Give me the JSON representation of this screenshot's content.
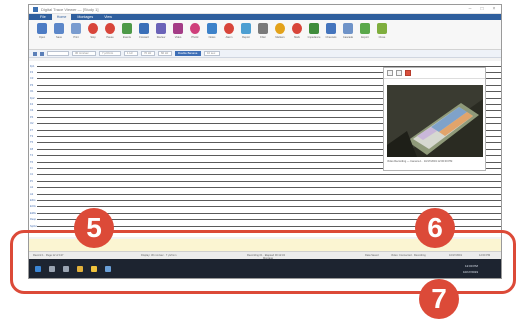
{
  "window": {
    "title": "Digital Trace Viewer — [Study 1]"
  },
  "menubar": {
    "items": [
      "File",
      "Home",
      "Montages",
      "View"
    ],
    "active_index": 1
  },
  "ribbon": {
    "buttons": [
      {
        "label": "Open",
        "color": "#4d7cc4",
        "shape": "square"
      },
      {
        "label": "Save",
        "color": "#5c87c9",
        "shape": "square"
      },
      {
        "label": "Print",
        "color": "#7a9ccf",
        "shape": "square"
      },
      {
        "label": "Stop",
        "color": "#d8453a",
        "shape": "round"
      },
      {
        "label": "Pause",
        "color": "#d8453a",
        "shape": "round"
      },
      {
        "label": "Events",
        "color": "#4e9a48",
        "shape": "square"
      },
      {
        "label": "Forward",
        "color": "#3a6fb8",
        "shape": "square"
      },
      {
        "label": "Review",
        "color": "#6b63b8",
        "shape": "square"
      },
      {
        "label": "Video",
        "color": "#a43c86",
        "shape": "square"
      },
      {
        "label": "Photic",
        "color": "#cf3f7b",
        "shape": "round"
      },
      {
        "label": "Notes",
        "color": "#3d82c9",
        "shape": "square"
      },
      {
        "label": "Alarm",
        "color": "#d8453a",
        "shape": "round"
      },
      {
        "label": "Report",
        "color": "#4d9fd2",
        "shape": "square"
      },
      {
        "label": "Filter",
        "color": "#7a7a7a",
        "shape": "square"
      },
      {
        "label": "Markers",
        "color": "#e3a21a",
        "shape": "round"
      },
      {
        "label": "Mark",
        "color": "#d8453a",
        "shape": "round"
      },
      {
        "label": "Impedance",
        "color": "#3f8c3b",
        "shape": "square"
      },
      {
        "label": "Channels",
        "color": "#4575bd",
        "shape": "square"
      },
      {
        "label": "Cascade",
        "color": "#6f93c8",
        "shape": "square"
      },
      {
        "label": "Export",
        "color": "#5aa84a",
        "shape": "square"
      },
      {
        "label": "Close",
        "color": "#7fae3e",
        "shape": "square"
      }
    ]
  },
  "filterbar": {
    "fields": [
      {
        "value": "",
        "selected": false
      },
      {
        "value": "30 mm/sec",
        "selected": false
      },
      {
        "value": "7 µV/mm",
        "selected": false
      },
      {
        "value": "1 Hz",
        "selected": false
      },
      {
        "value": "70 Hz",
        "selected": false
      },
      {
        "value": "60 Hz",
        "selected": false
      },
      {
        "value": "Double Banana",
        "selected": true
      },
      {
        "value": "10 sec",
        "selected": false
      }
    ]
  },
  "traces": {
    "channel_labels": [
      "Fp1",
      "F3",
      "C3",
      "P3",
      "O1",
      "Fp2",
      "F4",
      "C4",
      "P4",
      "O2",
      "F7",
      "T3",
      "T5",
      "F8",
      "T4",
      "T6",
      "Fz",
      "Cz",
      "Pz",
      "A1",
      "A2",
      "EKG",
      "EOG",
      "EMG",
      "Resp",
      "SpO2",
      "Ev1"
    ]
  },
  "video": {
    "caption": "Video Recording — Camera 1 · 10/17/2019 12:00:00 PM"
  },
  "statusbar": {
    "left": "Record 1 · Page 12 of 137",
    "mid_left": "Display: 30 mm/sec · 7 µV/mm",
    "center": "Recording 01 · Elapsed 00:12:34",
    "center_sub": "Montage",
    "right1": "Data Saved",
    "right2": "Video: Connected · Recording",
    "right3": "10/17/2019",
    "right4": "12:00 PM"
  },
  "taskbar": {
    "time": "12:00 PM",
    "date": "10/17/2019",
    "items": [
      {
        "name": "start",
        "color": "#3b86d6"
      },
      {
        "name": "search",
        "color": "#9aa4b2"
      },
      {
        "name": "task-view",
        "color": "#9aa4b2"
      },
      {
        "name": "browser",
        "color": "#e2b13c"
      },
      {
        "name": "explorer",
        "color": "#f0c33c"
      },
      {
        "name": "app",
        "color": "#6aa0d8"
      }
    ]
  },
  "callouts": [
    {
      "number": "5",
      "target": "status bar"
    },
    {
      "number": "6",
      "target": "scroll bar"
    },
    {
      "number": "7",
      "target": "taskbar"
    }
  ],
  "colors": {
    "accent": "#dc4a38",
    "menubar": "#2f5f9e"
  }
}
